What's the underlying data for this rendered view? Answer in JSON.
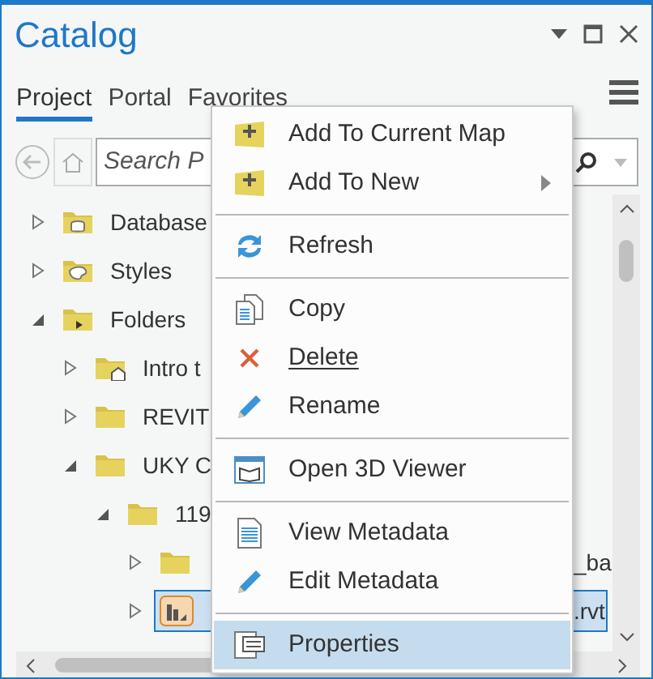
{
  "window": {
    "title": "Catalog"
  },
  "tabs": [
    {
      "label": "Project",
      "selected": true
    },
    {
      "label": "Portal",
      "selected": false
    },
    {
      "label": "Favorites",
      "selected": false
    }
  ],
  "search": {
    "placeholder": "Search P"
  },
  "tree": [
    {
      "label": "Database",
      "expanded": false,
      "selected": false
    },
    {
      "label": "Styles",
      "expanded": false,
      "selected": false
    },
    {
      "label": "Folders",
      "expanded": true,
      "selected": false,
      "children": [
        {
          "label": "Intro t",
          "expanded": false,
          "selected": false
        },
        {
          "label": "REVIT",
          "expanded": false,
          "selected": false
        },
        {
          "label": "UKY C",
          "expanded": true,
          "selected": false,
          "children": [
            {
              "label": "119",
              "expanded": true,
              "selected": false,
              "children": [
                {
                  "suffix": "_ba",
                  "expanded": false,
                  "selected": false
                },
                {
                  "suffix": ".rvt",
                  "expanded": false,
                  "selected": true
                }
              ]
            }
          ]
        }
      ]
    }
  ],
  "context_menu": [
    {
      "kind": "item",
      "label": "Add To Current Map",
      "submenu": false,
      "selected": false
    },
    {
      "kind": "item",
      "label": "Add To New",
      "submenu": true,
      "selected": false
    },
    {
      "kind": "separator"
    },
    {
      "kind": "item",
      "label": "Refresh",
      "submenu": false,
      "selected": false
    },
    {
      "kind": "separator"
    },
    {
      "kind": "item",
      "label": "Copy",
      "submenu": false,
      "selected": false
    },
    {
      "kind": "item",
      "label": "Delete",
      "submenu": false,
      "selected": false,
      "underline_first": true
    },
    {
      "kind": "item",
      "label": "Rename",
      "submenu": false,
      "selected": false
    },
    {
      "kind": "separator"
    },
    {
      "kind": "item",
      "label": "Open 3D Viewer",
      "submenu": false,
      "selected": false
    },
    {
      "kind": "separator"
    },
    {
      "kind": "item",
      "label": "View Metadata",
      "submenu": false,
      "selected": false
    },
    {
      "kind": "item",
      "label": "Edit Metadata",
      "submenu": false,
      "selected": false
    },
    {
      "kind": "separator"
    },
    {
      "kind": "item",
      "label": "Properties",
      "submenu": false,
      "selected": true
    }
  ]
}
